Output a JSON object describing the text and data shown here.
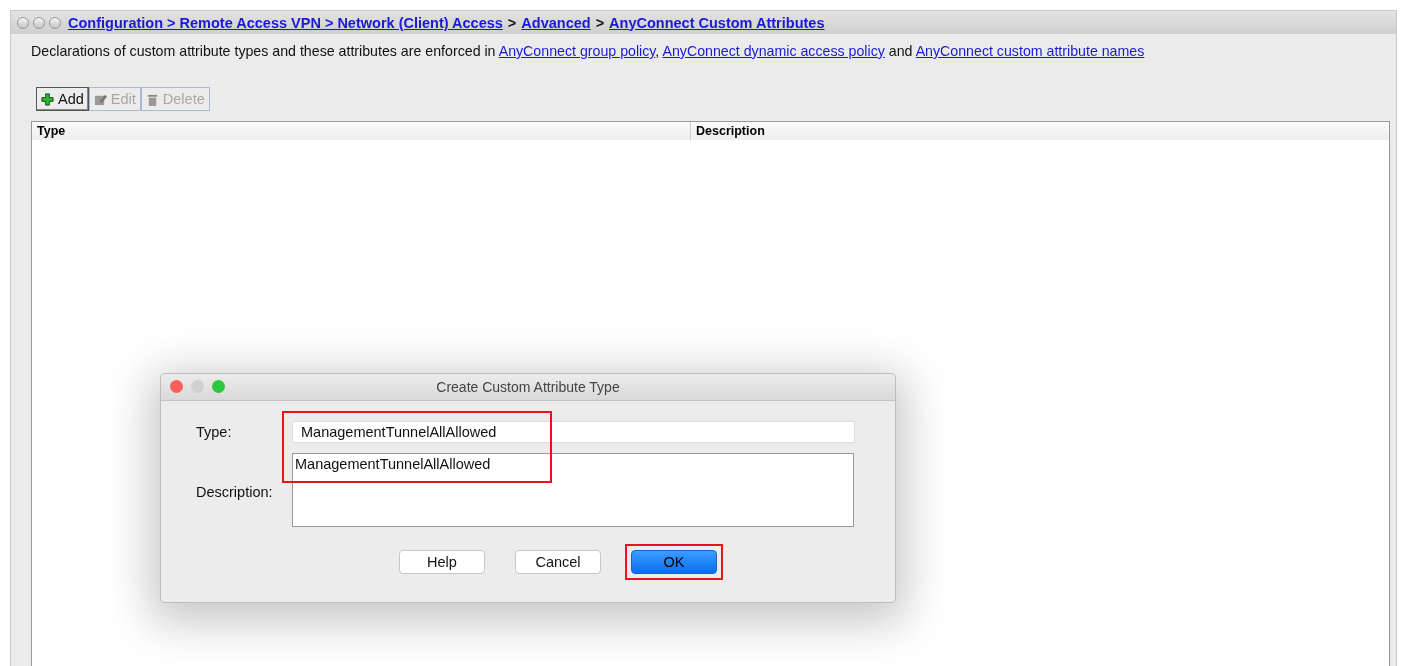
{
  "breadcrumb": [
    {
      "kind": "link",
      "text": "Configuration > Remote Access VPN > Network (Client) Access"
    },
    {
      "kind": "sep",
      "text": ">"
    },
    {
      "kind": "link",
      "text": "Advanced"
    },
    {
      "kind": "sep",
      "text": ">"
    },
    {
      "kind": "link",
      "text": "AnyConnect Custom Attributes"
    }
  ],
  "description": [
    {
      "kind": "text",
      "text": "Declarations of custom attribute types and these attributes are enforced in "
    },
    {
      "kind": "link",
      "text": "AnyConnect group policy"
    },
    {
      "kind": "text",
      "text": ", "
    },
    {
      "kind": "link",
      "text": "AnyConnect dynamic access policy"
    },
    {
      "kind": "text",
      "text": " and "
    },
    {
      "kind": "link",
      "text": "AnyConnect custom attribute names"
    }
  ],
  "toolbar": [
    {
      "kind": "add",
      "label": "Add",
      "disabled": false
    },
    {
      "kind": "edit",
      "label": "Edit",
      "disabled": true
    },
    {
      "kind": "delete",
      "label": "Delete",
      "disabled": true
    }
  ],
  "table": {
    "columns": [
      "Type",
      "Description"
    ]
  },
  "dialog": {
    "title": "Create Custom Attribute Type",
    "type_label": "Type:",
    "type_value": "ManagementTunnelAllAllowed",
    "description_label": "Description:",
    "description_value": "ManagementTunnelAllAllowed",
    "fields_highlighted": true,
    "buttons": [
      {
        "label": "Help",
        "default": false,
        "highlighted": false
      },
      {
        "label": "Cancel",
        "default": false,
        "highlighted": false
      },
      {
        "label": "OK",
        "default": true,
        "highlighted": true
      }
    ]
  }
}
